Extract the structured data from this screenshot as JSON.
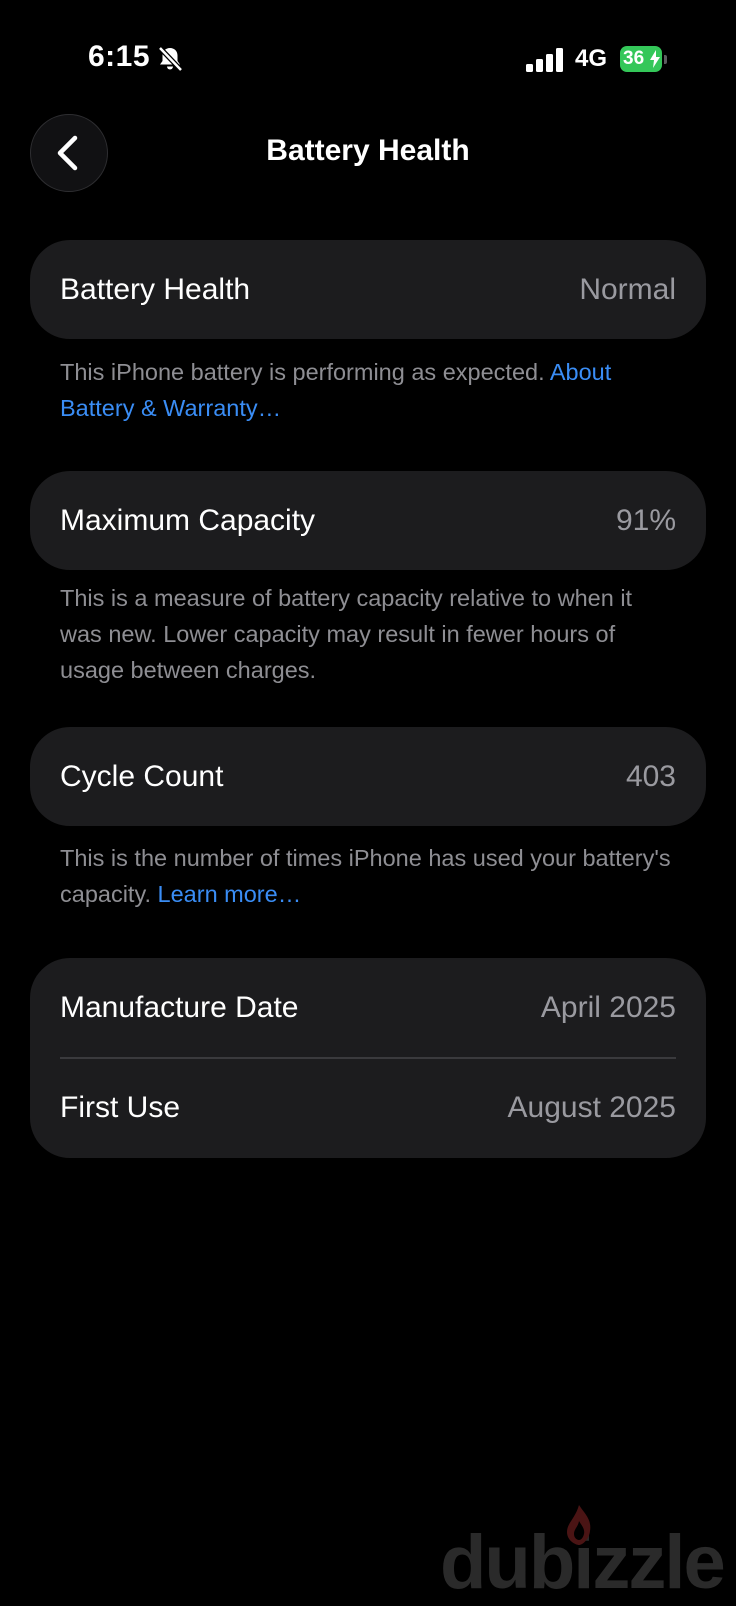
{
  "status_bar": {
    "time": "6:15",
    "network": "4G",
    "battery_level": "36"
  },
  "nav": {
    "title": "Battery Health"
  },
  "battery_health": {
    "label": "Battery Health",
    "value": "Normal",
    "footnote_text": "This iPhone battery is performing as expected. ",
    "footnote_link": "About Battery & Warranty…"
  },
  "maximum_capacity": {
    "label": "Maximum Capacity",
    "value": "91%",
    "footnote_text": "This is a measure of battery capacity relative to when it was new. Lower capacity may result in fewer hours of usage between charges."
  },
  "cycle_count": {
    "label": "Cycle Count",
    "value": "403",
    "footnote_text": "This is the number of times iPhone has used your battery's capacity. ",
    "footnote_link": "Learn more…"
  },
  "dates": {
    "manufacture_label": "Manufacture Date",
    "manufacture_value": "April 2025",
    "first_use_label": "First Use",
    "first_use_value": "August 2025"
  },
  "watermark": {
    "text": "dubizzle"
  },
  "colors": {
    "background": "#000000",
    "card": "#1c1c1e",
    "link": "#3a8df5",
    "battery": "#34c759",
    "secondary_text": "#9a9aa0"
  }
}
